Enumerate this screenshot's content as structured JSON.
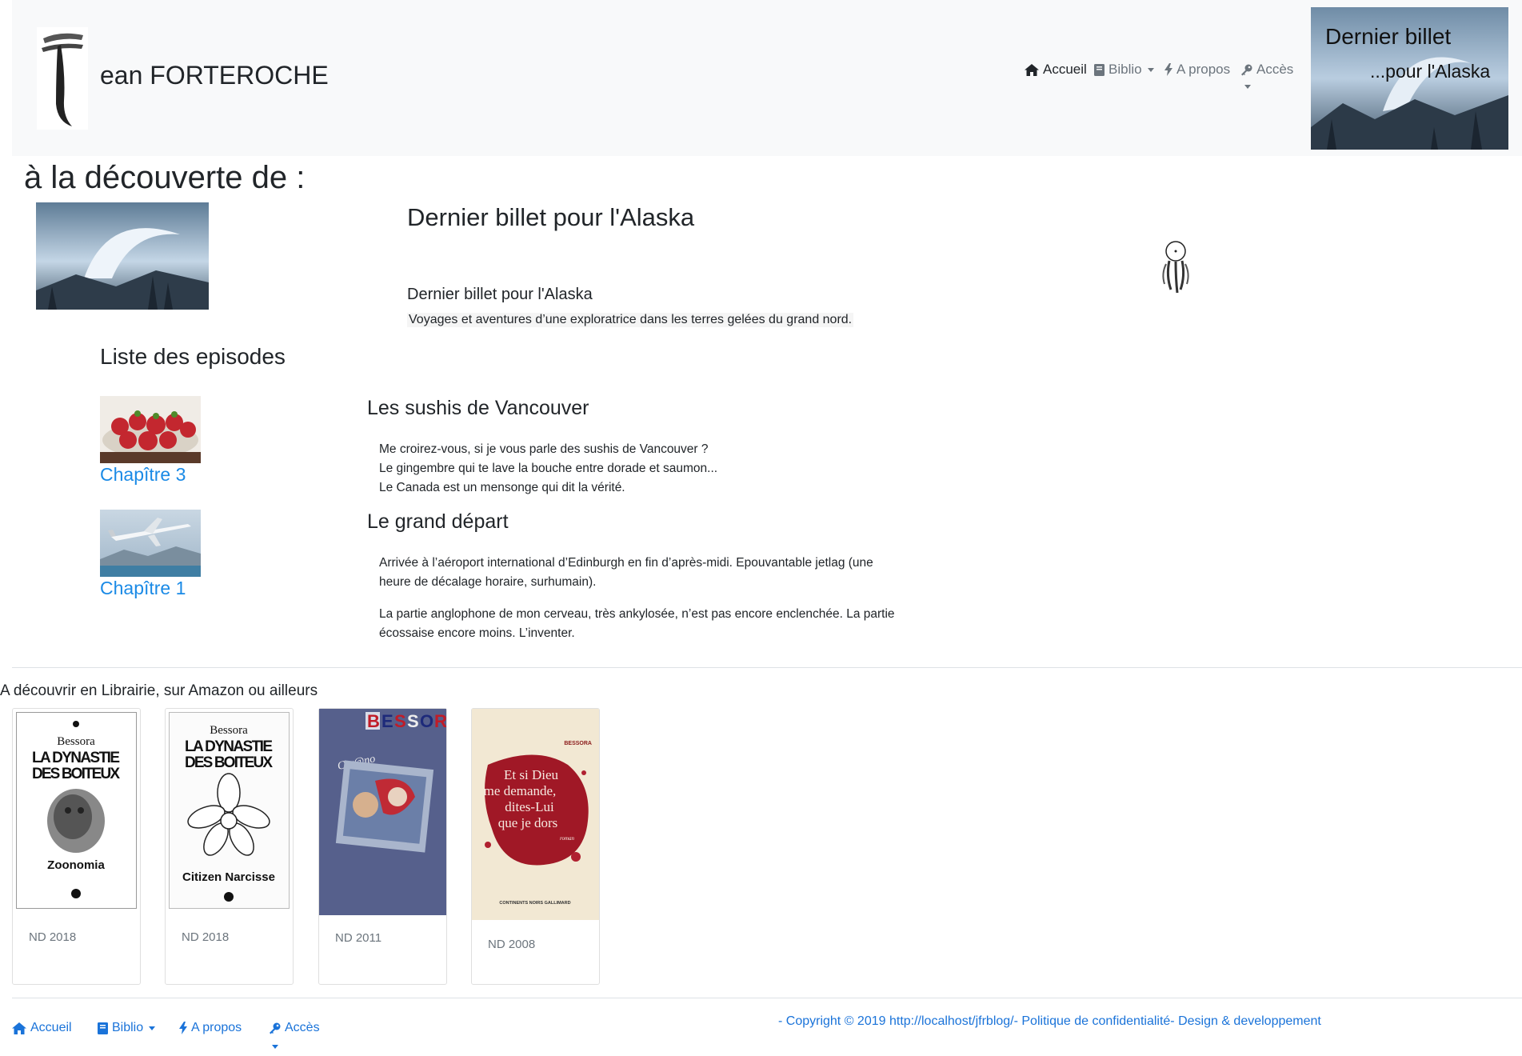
{
  "header": {
    "brand": "ean FORTEROCHE",
    "nav": {
      "accueil": "Accueil",
      "biblio": "Biblio",
      "apropos": "A propos",
      "acces": "Accès"
    },
    "banner": {
      "title": "Dernier billet",
      "subtitle": "...pour l'Alaska"
    }
  },
  "main": {
    "heading": "à la découverte de :",
    "book": {
      "title": "Dernier billet pour l'Alaska",
      "subtitle": "Dernier billet pour l'Alaska",
      "description": "Voyages et aventures d’une exploratrice dans les terres gelées du grand nord."
    },
    "episodes_heading": "Liste des episodes",
    "episodes": [
      {
        "link": "Chapître 3",
        "title": "Les sushis de Vancouver",
        "lines": [
          "Me croirez-vous, si je vous parle des sushis de Vancouver ?",
          "Le gingembre qui te lave la bouche entre dorade et saumon...",
          "Le Canada est un mensonge qui dit la vérité."
        ]
      },
      {
        "link": "Chapître 1",
        "title": "Le grand départ",
        "lines": [
          "Arrivée à l’aéroport international d’Edinburgh en fin d’après-midi. Epouvantable jetlag (une",
          "heure de décalage horaire, surhumain).",
          "La partie anglophone de mon cerveau, très ankylosée, n’est pas encore enclenchée. La partie",
          "écossaise encore moins. L’inventer."
        ]
      }
    ]
  },
  "librairie": {
    "heading": "A découvrir en Librairie, sur Amazon ou ailleurs",
    "books": [
      {
        "year": "ND 2018",
        "cover_author": "Bessora",
        "cover_title": "LA DYNASTIE DES BOITEUX",
        "cover_sub": "Zoonomia"
      },
      {
        "year": "ND 2018",
        "cover_author": "Bessora",
        "cover_title": "LA DYNASTIE DES BOITEUX",
        "cover_sub": "Citizen Narcisse"
      },
      {
        "year": "ND 2011",
        "cover_author": "BESSORA",
        "cover_title": "Cyr@no",
        "cover_sub": ""
      },
      {
        "year": "ND 2008",
        "cover_author": "BESSORA",
        "cover_title": "Et si Dieu me demande, dites-Lui que je dors",
        "cover_sub": "roman",
        "cover_footer": "CONTINENTS NOIRS  GALLIMARD"
      }
    ]
  },
  "footer": {
    "nav": {
      "accueil": "Accueil",
      "biblio": "Biblio",
      "apropos": "A propos",
      "acces": "Accès"
    },
    "copyright": "- Copyright © 2019 http://localhost/jfrblog/- Politique de confidentialité- Design & developpement"
  },
  "colors": {
    "link": "#1a8ae6",
    "header_bg": "#f8f9fa",
    "muted": "#6c757d"
  }
}
